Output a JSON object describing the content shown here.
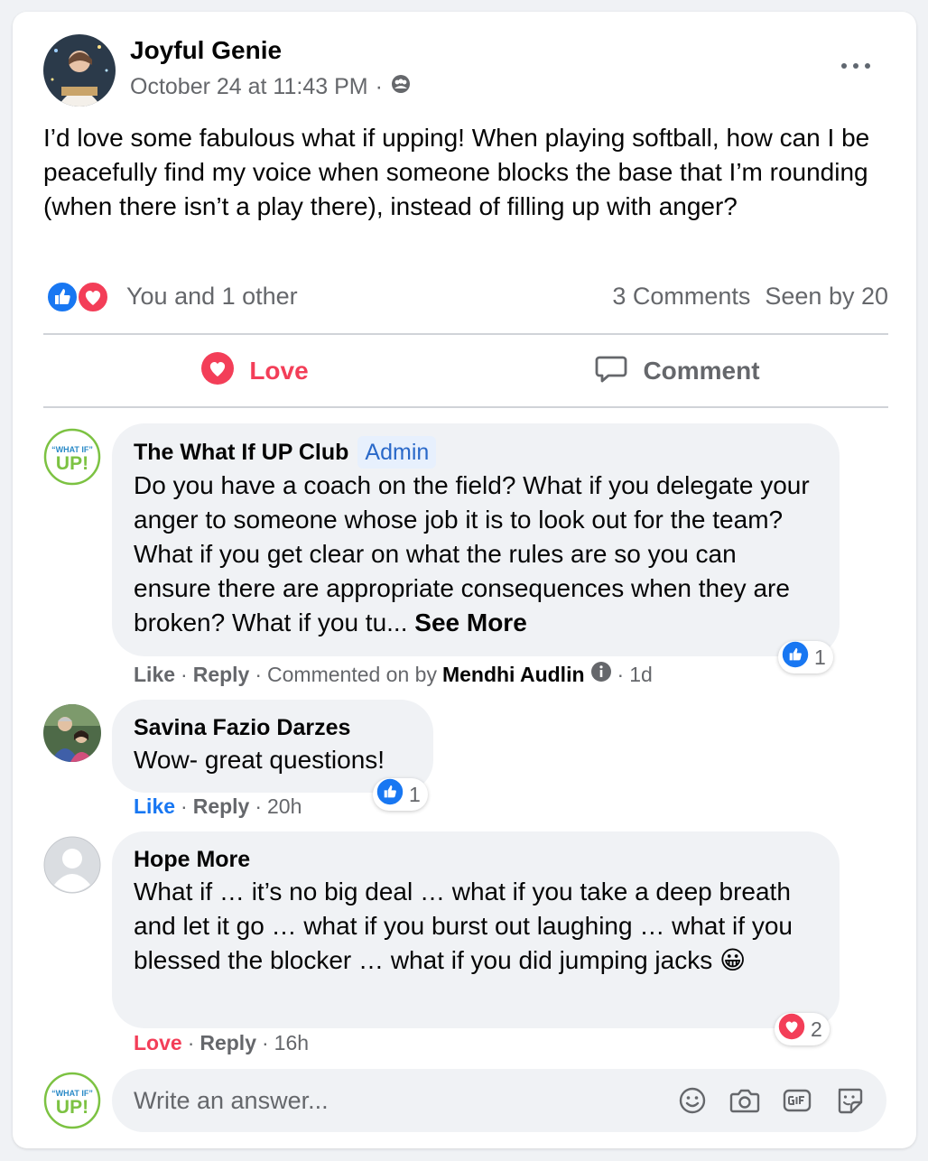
{
  "post": {
    "author": "Joyful Genie",
    "timestamp": "October 24 at 11:43 PM",
    "separator": "·",
    "audience_icon": "group-icon",
    "text": "I’d love some fabulous what if upping! When playing softball, how can I be peacefully find my voice when someone blocks the base that I’m rounding (when there isn’t a play there), instead of filling up with anger?",
    "reactions_text": "You and 1 other",
    "comments_count": "3 Comments",
    "seen_by": "Seen by 20"
  },
  "actions": {
    "love_label": "Love",
    "comment_label": "Comment"
  },
  "comments": [
    {
      "author": "The What If UP Club",
      "badge": "Admin",
      "text": "Do you have a coach on the field? What if you delegate your anger to someone whose job it is to look out for the team? What if you get clear on what the rules are so you can ensure there are appropriate consequences when they are broken? What if you tu... ",
      "see_more": "See More",
      "like": "Like",
      "reply": "Reply",
      "commented_on_by": "Commented on by",
      "commented_on_by_name": "Mendhi Audlin",
      "time": "1d",
      "reaction_count": "1"
    },
    {
      "author": "Savina Fazio Darzes",
      "text": "Wow- great questions!",
      "like": "Like",
      "reply": "Reply",
      "time": "20h",
      "reaction_count": "1"
    },
    {
      "author": "Hope More",
      "text": "What if … it’s no big deal … what if you take a deep breath and let it go … what if you burst out laughing … what if you blessed the blocker … what if you did jumping jacks 😀",
      "love": "Love",
      "reply": "Reply",
      "time": "16h",
      "reaction_count": "2"
    }
  ],
  "composer": {
    "placeholder": "Write an answer..."
  },
  "logo_text": {
    "line1": "“WHAT IF”",
    "line2": "UP!"
  },
  "colors": {
    "like_blue": "#1877f2",
    "love_red": "#f33e58",
    "secondary_text": "#65676b",
    "bubble_bg": "#f0f2f5",
    "logo_green": "#7cc242",
    "logo_blue": "#2a8ac7"
  }
}
